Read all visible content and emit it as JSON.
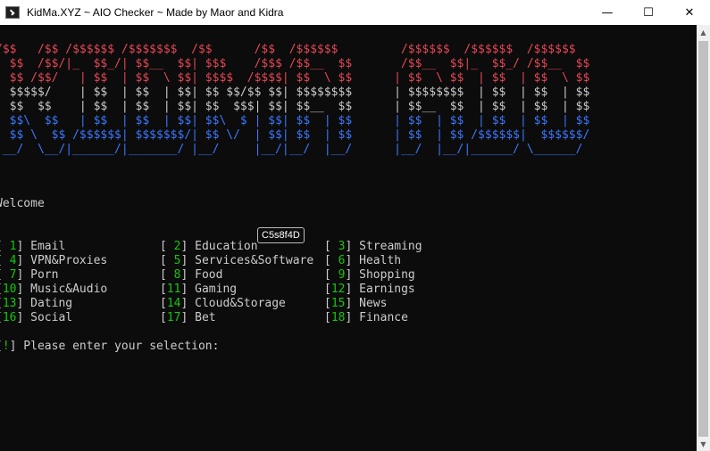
{
  "window": {
    "title": "KidMa.XYZ ~ AIO Checker ~ Made by Maor and Kidra",
    "buttons": {
      "minimize": "—",
      "maximize": "☐",
      "close": "✕"
    }
  },
  "banner": [
    {
      "color": "red",
      "text": "/$$   /$$ /$$$$$$ /$$$$$$$  /$$      /$$  /$$$$$$         /$$$$$$  /$$$$$$  /$$$$$$"
    },
    {
      "color": "red",
      "text": "| $$  /$$/|_  $$_/| $$__  $$| $$$    /$$$ /$$__  $$       /$$__  $$|_  $$_/ /$$__  $$"
    },
    {
      "color": "red",
      "text": "| $$ /$$/   | $$  | $$  \\ $$| $$$$  /$$$$| $$  \\ $$      | $$  \\ $$  | $$  | $$  \\ $$"
    },
    {
      "color": "white",
      "text": "| $$$$$/    | $$  | $$  | $$| $$ $$/$$ $$| $$$$$$$$      | $$$$$$$$  | $$  | $$  | $$"
    },
    {
      "color": "white",
      "text": "| $$  $$    | $$  | $$  | $$| $$  $$$| $$| $$__  $$      | $$__  $$  | $$  | $$  | $$"
    },
    {
      "color": "blue",
      "text": "| $$\\  $$   | $$  | $$  | $$| $$\\  $ | $$| $$  | $$      | $$  | $$  | $$  | $$  | $$"
    },
    {
      "color": "blue",
      "text": "| $$ \\  $$ /$$$$$$| $$$$$$$/| $$ \\/  | $$| $$  | $$      | $$  | $$ /$$$$$$|  $$$$$$/"
    },
    {
      "color": "blue",
      "text": "|__/  \\__/|______/|_______/ |__/     |__/|__/  |__/      |__/  |__/|______/ \\______/"
    }
  ],
  "welcome": "Welcome",
  "menu_rows": [
    [
      {
        "num": " 1",
        "label": "Email"
      },
      {
        "num": " 2",
        "label": "Education"
      },
      {
        "num": " 3",
        "label": "Streaming"
      }
    ],
    [
      {
        "num": " 4",
        "label": "VPN&Proxies"
      },
      {
        "num": " 5",
        "label": "Services&Software"
      },
      {
        "num": " 6",
        "label": "Health"
      }
    ],
    [
      {
        "num": " 7",
        "label": "Porn"
      },
      {
        "num": " 8",
        "label": "Food"
      },
      {
        "num": " 9",
        "label": "Shopping"
      }
    ],
    [
      {
        "num": "10",
        "label": "Music&Audio"
      },
      {
        "num": "11",
        "label": "Gaming"
      },
      {
        "num": "12",
        "label": "Earnings"
      }
    ],
    [
      {
        "num": "13",
        "label": "Dating"
      },
      {
        "num": "14",
        "label": "Cloud&Storage"
      },
      {
        "num": "15",
        "label": "News"
      }
    ],
    [
      {
        "num": "16",
        "label": "Social"
      },
      {
        "num": "17",
        "label": "Bet"
      },
      {
        "num": "18",
        "label": "Finance"
      }
    ]
  ],
  "prompt": {
    "open": "[",
    "mark": "!",
    "close": "]",
    "text": " Please enter your selection:"
  },
  "tooltip": "C5s8f4D"
}
